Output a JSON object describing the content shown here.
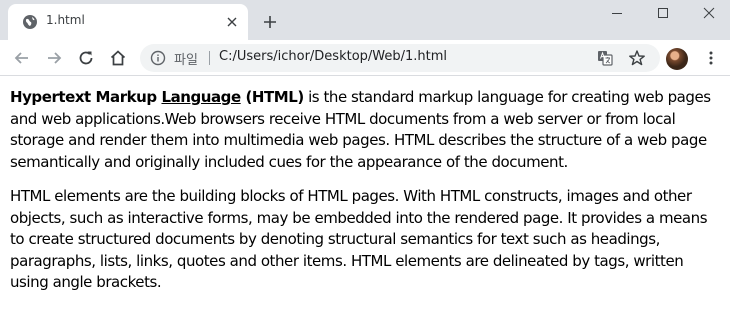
{
  "tab": {
    "title": "1.html"
  },
  "omnibox": {
    "site_label": "파일",
    "url": "C:/Users/ichor/Desktop/Web/1.html"
  },
  "page": {
    "p1": {
      "bold_prefix": "Hypertext Markup ",
      "bold_underlined": "Language",
      "bold_suffix": " (HTML)",
      "rest": " is the standard markup language for creating web pages and web applications.Web browsers receive HTML documents from a web server or from local storage and render them into multimedia web pages. HTML describes the structure of a web page semantically and originally included cues for the appearance of the document."
    },
    "p2": "HTML elements are the building blocks of HTML pages. With HTML constructs, images and other objects, such as interactive forms, may be embedded into the rendered page. It provides a means to create structured documents by denoting structural semantics for text such as headings, paragraphs, lists, links, quotes and other items. HTML elements are delineated by tags, written using angle brackets."
  },
  "icons": {
    "favicon": "globe-icon",
    "tab_close": "close-icon",
    "new_tab": "plus-icon",
    "minimize": "minimize-icon",
    "maximize": "maximize-icon",
    "close_window": "close-window-icon",
    "back": "back-arrow-icon",
    "forward": "forward-arrow-icon",
    "reload": "reload-icon",
    "home": "home-icon",
    "site_info": "info-icon",
    "translate": "translate-icon",
    "bookmark": "star-icon",
    "profile": "avatar",
    "menu": "kebab-menu-icon"
  },
  "colors": {
    "tabbar": "#dee1e6",
    "omnibox": "#f1f3f4",
    "text": "#000000"
  }
}
